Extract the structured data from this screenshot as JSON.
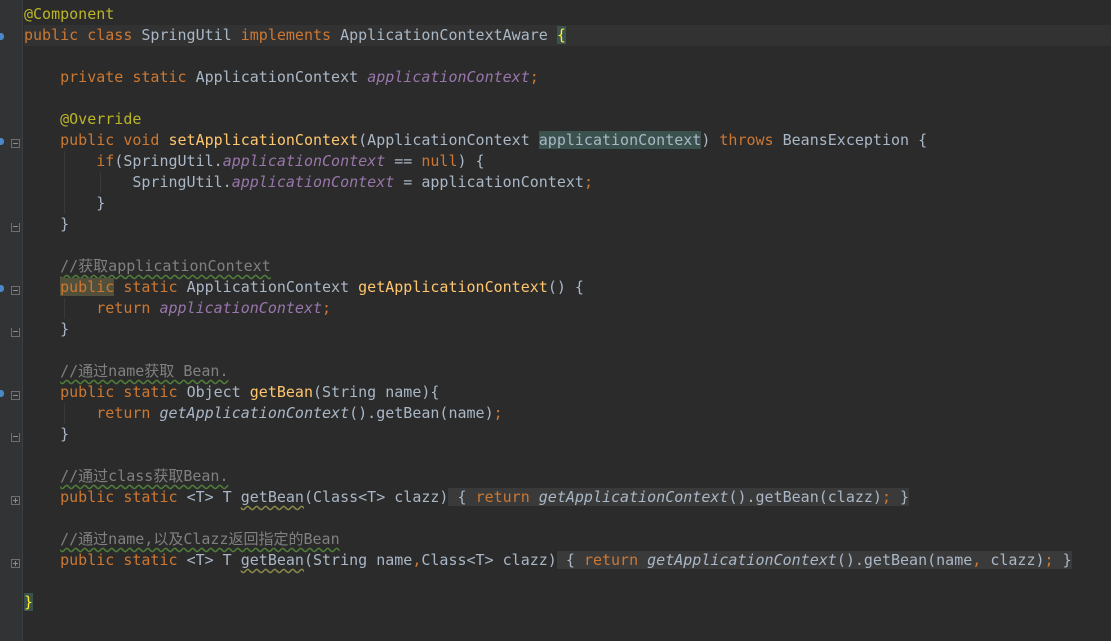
{
  "code": {
    "l1": "@Component",
    "l2_public": "public",
    "l2_class": "class",
    "l2_name": "SpringUtil",
    "l2_implements": "implements",
    "l2_iface": "ApplicationContextAware",
    "l2_brace": "{",
    "l4_private": "private",
    "l4_static": "static",
    "l4_type": "ApplicationContext",
    "l4_field": "applicationContext",
    "l4_semi": ";",
    "l6_override": "@Override",
    "l7_public": "public",
    "l7_void": "void",
    "l7_method": "setApplicationContext",
    "l7_open": "(ApplicationContext ",
    "l7_param": "applicationContext",
    "l7_close": ")",
    "l7_throws": "throws",
    "l7_exc": "BeansException {",
    "l8_if": "if",
    "l8_open": "(SpringUtil.",
    "l8_field": "applicationContext",
    "l8_eq": " == ",
    "l8_null": "null",
    "l8_close": ") {",
    "l9_cls": "SpringUtil.",
    "l9_field": "applicationContext",
    "l9_assign": " = applicationContext",
    "l9_semi": ";",
    "l10": "}",
    "l11": "}",
    "l13_comment": "//获取applicationContext",
    "l14_public": "public",
    "l14_static": "static",
    "l14_type": "ApplicationContext",
    "l14_method": "getApplicationContext",
    "l14_rest": "() {",
    "l15_return": "return",
    "l15_field": "applicationContext",
    "l15_semi": ";",
    "l16": "}",
    "l18_comment": "//通过name获取 Bean.",
    "l19_public": "public",
    "l19_static": "static",
    "l19_type": "Object",
    "l19_method": "getBean",
    "l19_rest": "(String name){",
    "l20_return": "return",
    "l20_call": "getApplicationContext",
    "l20_rest": "().getBean(name)",
    "l20_semi": ";",
    "l21": "}",
    "l23_comment": "//通过class获取Bean.",
    "l24_public": "public",
    "l24_static": "static",
    "l24_generic": "<T> T",
    "l24_method": "getBean",
    "l24_sig": "(Class<T> clazz)",
    "l24_open": " { ",
    "l24_return": "return",
    "l24_call": "getApplicationContext",
    "l24_rest": "().getBean(clazz)",
    "l24_semi": ";",
    "l24_close": " }",
    "l26_comment": "//通过name,以及Clazz返回指定的Bean",
    "l27_public": "public",
    "l27_static": "static",
    "l27_generic": "<T> T",
    "l27_method": "getBean",
    "l27_sig1": "(String name",
    "l27_comma": ",",
    "l27_sig2": "Class<T> clazz)",
    "l27_open": " { ",
    "l27_return": "return",
    "l27_call": "getApplicationContext",
    "l27_rest1": "().getBean(name",
    "l27_comma2": ",",
    "l27_rest2": " clazz)",
    "l27_semi": ";",
    "l27_close": " }",
    "l29_brace": "}"
  },
  "colors": {
    "background": "#2b2b2b",
    "keyword": "#cc7832",
    "annotation": "#bbb529",
    "field": "#9876aa",
    "method": "#ffc66d",
    "comment": "#808080",
    "text": "#a9b7c6"
  },
  "icons": {
    "fold": "fold-marker-icon",
    "folded": "folded-block-plus-icon",
    "implements": "implements-gutter-icon"
  }
}
